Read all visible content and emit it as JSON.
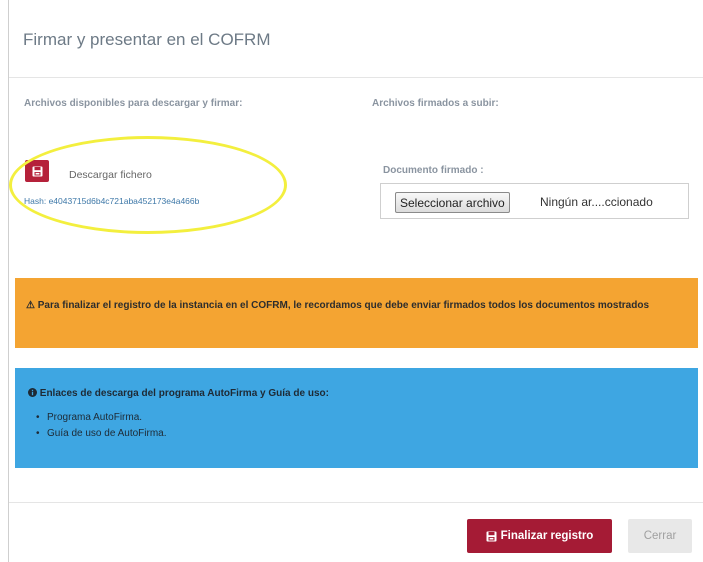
{
  "modal": {
    "title": "Firmar y presentar en el COFRM"
  },
  "download_section": {
    "heading": "Archivos disponibles para descargar y firmar:",
    "download_label": "Descargar fichero",
    "hash": "Hash: e4043715d6b4c721aba452173e4a466b",
    "button_icon": "floppy-disk-icon"
  },
  "upload_section": {
    "heading": "Archivos firmados a subir:",
    "document_label": "Documento firmado :",
    "file_button_label": "Seleccionar archivo",
    "file_status": "Ningún ar....ccionado"
  },
  "warning_alert": {
    "icon": "warning-triangle-icon",
    "text": "Para finalizar el registro de la instancia en el COFRM, le recordamos que debe enviar firmados todos los documentos mostrados",
    "color": "#f4a432"
  },
  "info_alert": {
    "icon": "info-circle-icon",
    "title": "Enlaces de descarga del programa AutoFirma y Guía de uso:",
    "links": [
      "Programa AutoFirma.",
      "Guía de uso de AutoFirma."
    ],
    "color": "#3ea6e2"
  },
  "footer": {
    "finalize_label": "Finalizar registro",
    "finalize_icon": "floppy-disk-icon",
    "close_label": "Cerrar"
  },
  "colors": {
    "primary": "#a51b35",
    "highlight": "#f3ef3e"
  }
}
